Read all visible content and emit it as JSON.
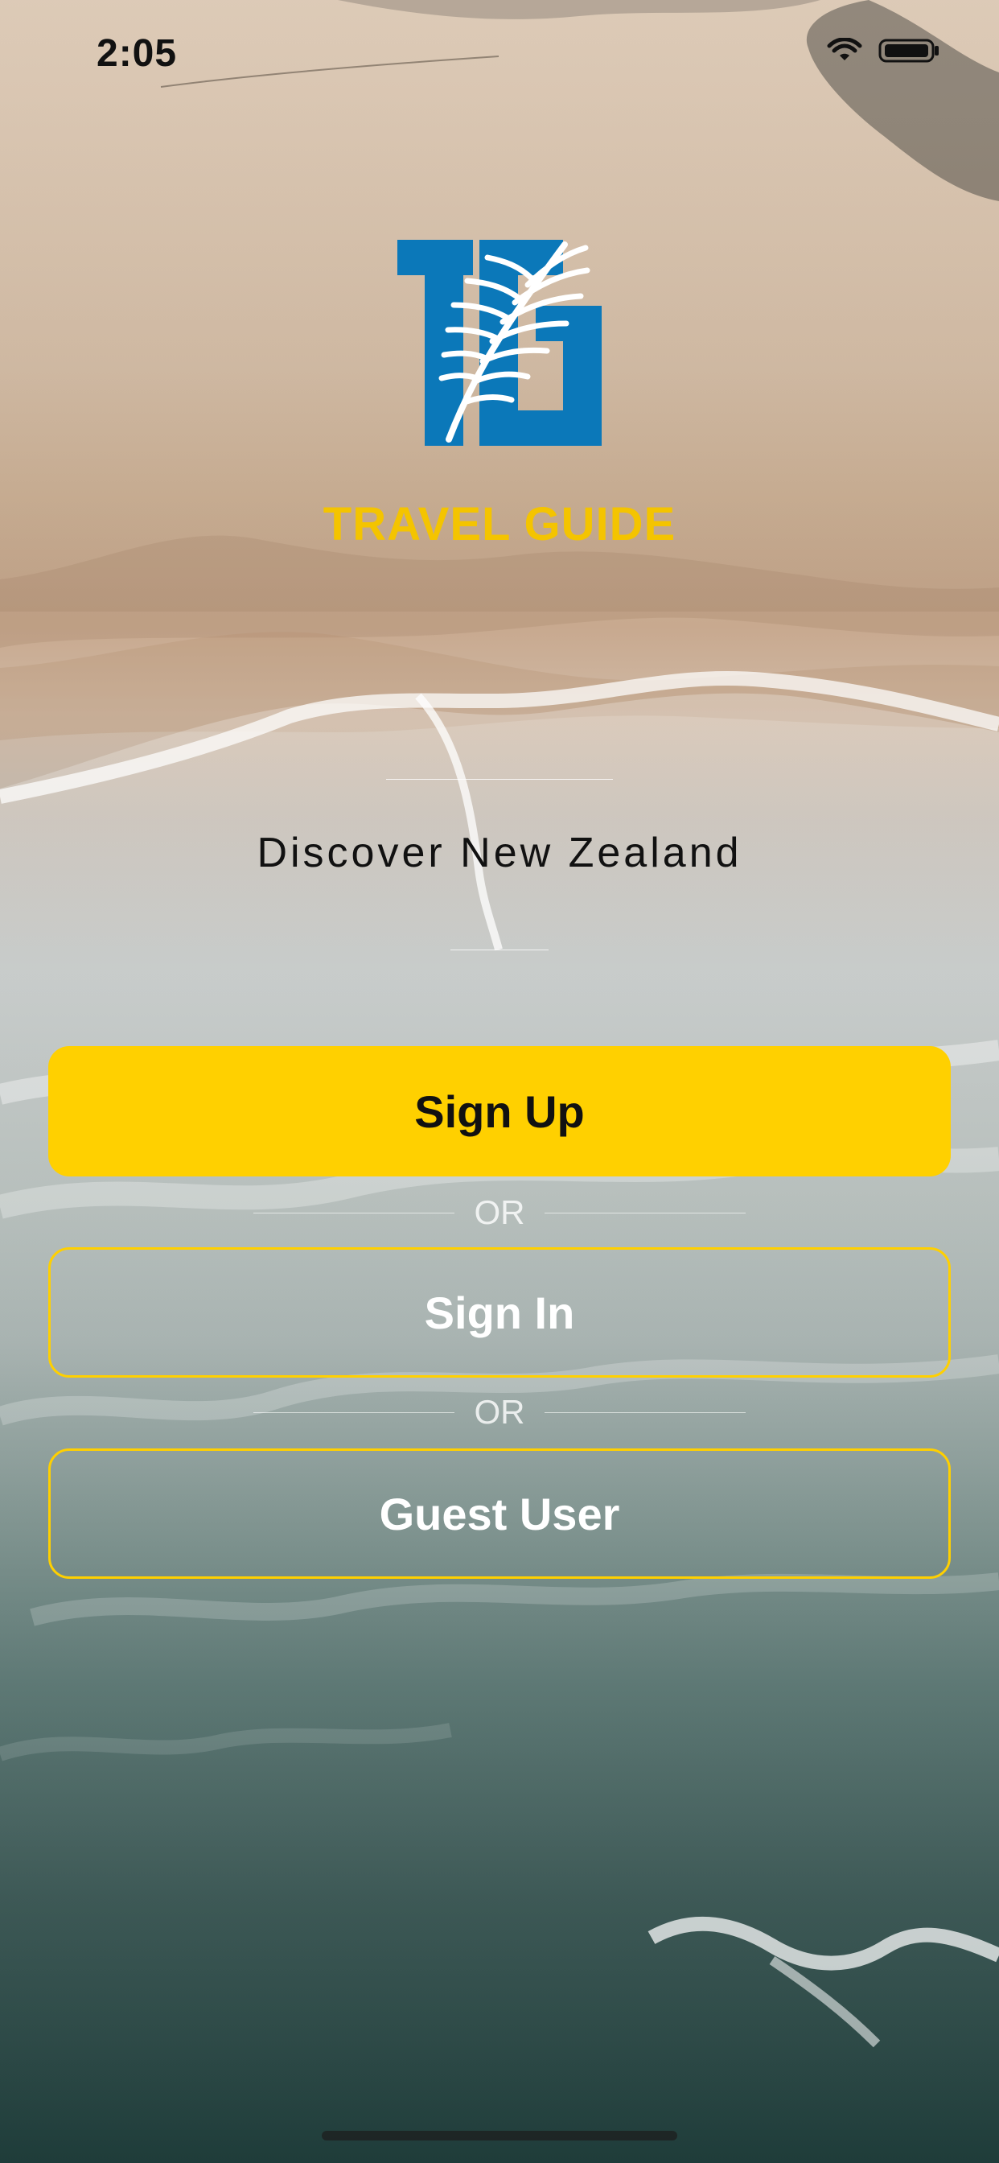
{
  "status_bar": {
    "time": "2:05",
    "icons": [
      "wifi-icon",
      "battery-icon"
    ]
  },
  "app": {
    "logo_icon": "travel-guide-logo",
    "brand_name": "TRAVEL GUIDE",
    "tagline": "Discover New Zealand"
  },
  "buttons": {
    "sign_up": "Sign Up",
    "sign_in": "Sign In",
    "guest": "Guest User"
  },
  "dividers": {
    "or_1": "OR",
    "or_2": "OR"
  },
  "colors": {
    "accent": "#ffd000",
    "logo_blue": "#0b78b9",
    "brand_text": "#f4c400"
  }
}
